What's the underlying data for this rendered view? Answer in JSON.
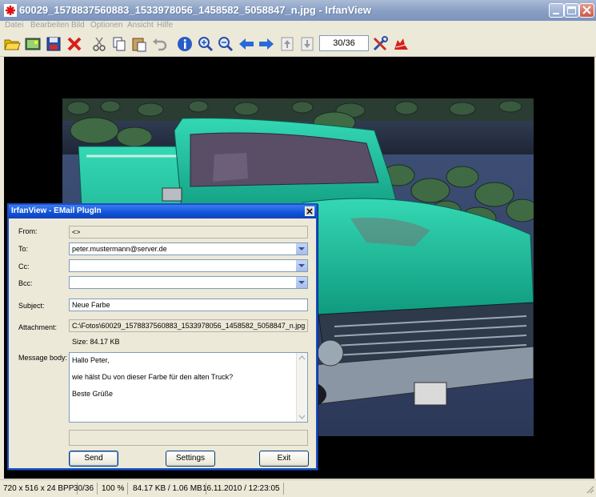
{
  "window": {
    "title": "60029_1578837560883_1533978056_1458582_5058847_n.jpg - IrfanView",
    "app_icon": "irfanview-red-cat-icon",
    "controls": [
      "minimize-icon",
      "maximize-icon",
      "close-icon"
    ]
  },
  "menu": [
    "Datei",
    "Bearbeiten",
    "Bild",
    "Optionen",
    "Ansicht",
    "Hilfe"
  ],
  "toolbar": {
    "buttons": [
      "open-folder-icon",
      "slideshow-icon",
      "save-icon",
      "delete-icon",
      "cut-icon",
      "copy-icon",
      "paste-icon",
      "undo-icon",
      "info-icon",
      "zoom-in-icon",
      "zoom-out-icon",
      "previous-icon",
      "next-icon",
      "first-icon",
      "last-icon",
      "settings-tools-icon",
      "exit-cat-icon"
    ],
    "page_counter": "30/36"
  },
  "status_bar": {
    "dimensions": "720 x 516 x 24 BPP",
    "position": "30/36",
    "zoom": "100 %",
    "size": "84.17 KB / 1.06 MB",
    "datetime": "16.11.2010 / 12:23:05"
  },
  "dialog": {
    "title": "IrfanView - EMail PlugIn",
    "from_label": "From:",
    "from_value": "<>",
    "to_label": "To:",
    "to_value": "peter.mustermann@server.de",
    "cc_label": "Cc:",
    "cc_value": "",
    "bcc_label": "Bcc:",
    "bcc_value": "",
    "subject_label": "Subject:",
    "subject_value": "Neue Farbe",
    "attachment_label": "Attachment:",
    "attachment_value": "C:\\Fotos\\60029_1578837560883_1533978056_1458582_5058847_n.jpg",
    "size_text": "Size:  84.17 KB",
    "body_label": "Message body:",
    "body_lines": [
      "Hallo Peter,",
      "wie hälst Du von dieser Farbe für den alten Truck?",
      "Beste Grüße"
    ],
    "send_label": "Send",
    "settings_label": "Settings",
    "exit_label": "Exit"
  },
  "colors": {
    "titlebar_inactive": "#8aa0c4",
    "dialog_titlebar": "#0f52d8",
    "truck_turquoise": "#22c4a0"
  }
}
